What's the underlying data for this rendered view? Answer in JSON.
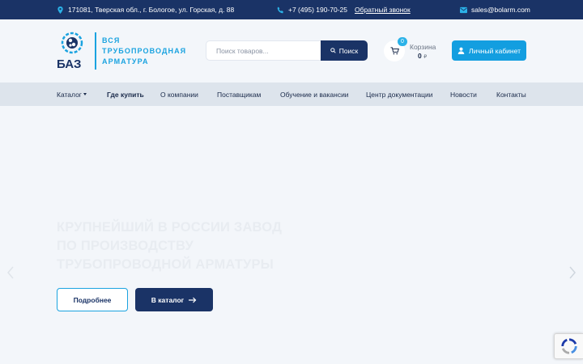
{
  "topbar": {
    "address": "171081, Тверская обл., г. Бологое, ул. Горская, д. 88",
    "phone": "+7 (495) 190-70-25",
    "callback": "Обратный звонок",
    "email": "sales@bolarm.com",
    "icons": [
      "location-pin-icon",
      "phone-icon",
      "mail-icon"
    ]
  },
  "header": {
    "logo_text": "БАЗ",
    "tagline": [
      "Вся",
      "трубопроводная",
      "арматура"
    ],
    "search_placeholder": "Поиск товаров...",
    "search_button": "Поиск",
    "cart_label": "Корзина",
    "cart_count": "0",
    "cart_amount": "0",
    "cart_currency": "₽",
    "cabinet_button": "Личный кабинет"
  },
  "nav": {
    "items": [
      "Каталог",
      "Где купить",
      "О компании",
      "Поставщикам",
      "Обучение и вакансии",
      "Центр документации",
      "Новости",
      "Контакты"
    ]
  },
  "hero": {
    "title_lines": [
      "Крупнейший в России завод",
      "по производству",
      "трубопроводной арматуры"
    ],
    "more_button": "Подробнее",
    "catalog_button": "В каталог"
  },
  "colors": {
    "brand_dark": "#1a3366",
    "brand_accent": "#1aa3e0",
    "background": "#f3f6fa",
    "nav_bg": "#dde4ec"
  }
}
